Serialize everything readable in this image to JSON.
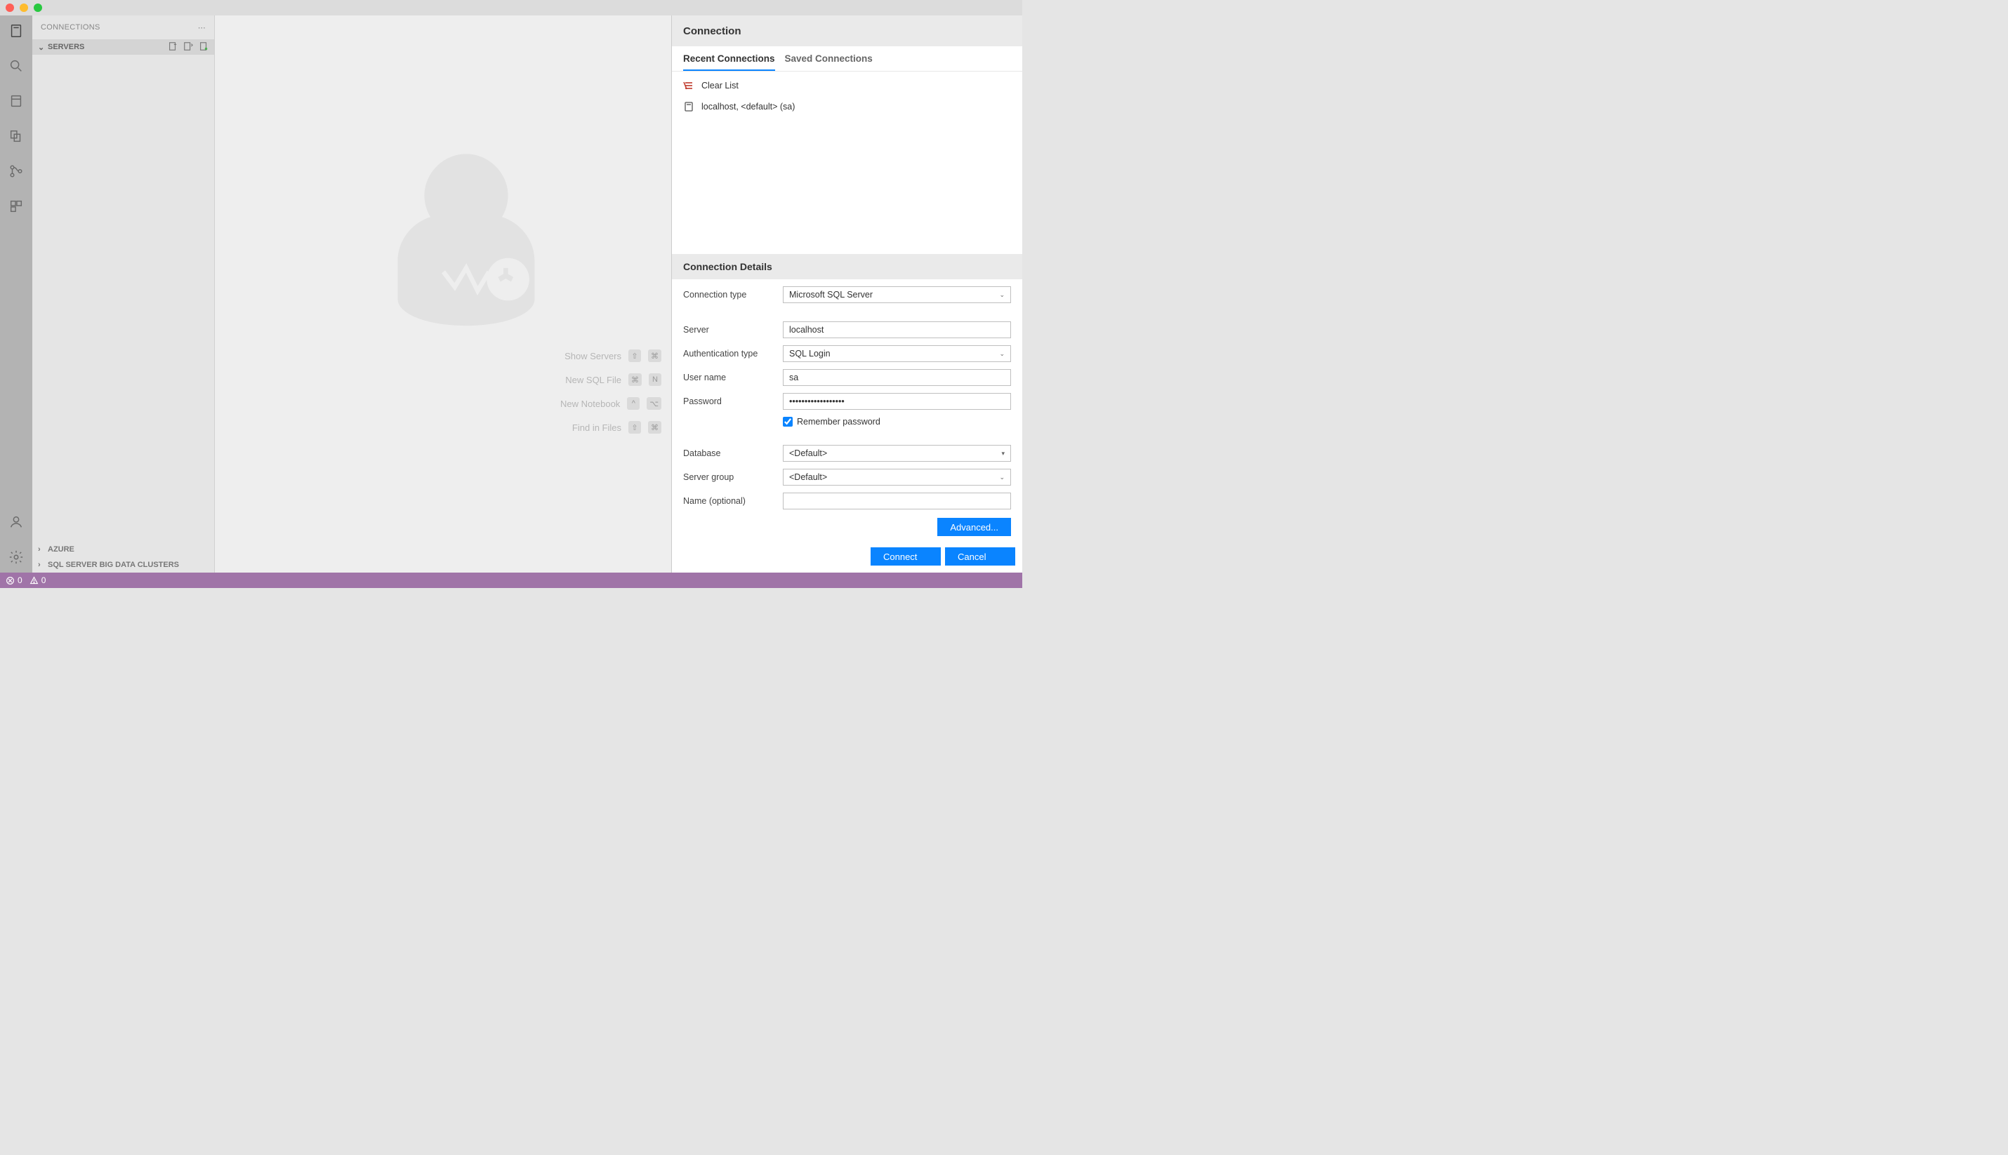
{
  "sidebar": {
    "title": "CONNECTIONS",
    "sections": {
      "servers": "SERVERS",
      "azure": "AZURE",
      "bigdata": "SQL SERVER BIG DATA CLUSTERS"
    }
  },
  "welcome": {
    "shortcuts": [
      {
        "label": "Show Servers",
        "keys": [
          "⇧",
          "⌘"
        ]
      },
      {
        "label": "New SQL File",
        "keys": [
          "⌘",
          "N"
        ]
      },
      {
        "label": "New Notebook",
        "keys": [
          "^",
          "⌥"
        ]
      },
      {
        "label": "Find in Files",
        "keys": [
          "⇧",
          "⌘"
        ]
      }
    ]
  },
  "panel": {
    "title": "Connection",
    "tabs": {
      "recent": "Recent Connections",
      "saved": "Saved Connections"
    },
    "clear_list": "Clear List",
    "recent_items": [
      "localhost, <default> (sa)"
    ],
    "details_title": "Connection Details",
    "form": {
      "connection_type_label": "Connection type",
      "connection_type_value": "Microsoft SQL Server",
      "server_label": "Server",
      "server_value": "localhost",
      "auth_label": "Authentication type",
      "auth_value": "SQL Login",
      "user_label": "User name",
      "user_value": "sa",
      "password_label": "Password",
      "password_value": "••••••••••••••••••",
      "remember_label": "Remember password",
      "database_label": "Database",
      "database_value": "<Default>",
      "servergroup_label": "Server group",
      "servergroup_value": "<Default>",
      "name_label": "Name (optional)",
      "name_value": ""
    },
    "advanced": "Advanced...",
    "connect": "Connect",
    "cancel": "Cancel"
  },
  "statusbar": {
    "errors": "0",
    "warnings": "0"
  }
}
